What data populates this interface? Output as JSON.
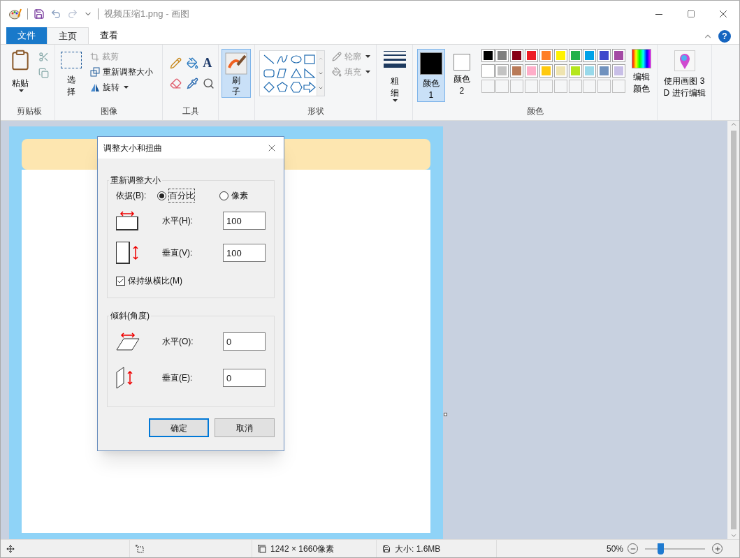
{
  "window": {
    "title": "视频压缩1.png - 画图",
    "help": "?"
  },
  "tabs": [
    {
      "label": "文件",
      "kind": "file",
      "selected": false
    },
    {
      "label": "主页",
      "kind": "tab",
      "selected": true
    },
    {
      "label": "查看",
      "kind": "tab",
      "selected": false
    }
  ],
  "ribbon": {
    "clipboard": {
      "paste": "粘贴",
      "group": "剪贴板"
    },
    "image": {
      "select": "选择",
      "crop": {
        "label": "裁剪",
        "disabled": true
      },
      "resize": {
        "label": "重新调整大小",
        "disabled": false
      },
      "rotate": {
        "label": "旋转",
        "disabled": false
      },
      "group": "图像"
    },
    "tools": {
      "text_tool": "A",
      "group": "工具"
    },
    "brushes": {
      "label": "刷子",
      "selected": true
    },
    "shapes": {
      "outline": {
        "label": "轮廓",
        "disabled": true
      },
      "fill": {
        "label": "填充",
        "disabled": true
      },
      "group": "形状"
    },
    "size": {
      "label": "粗细"
    },
    "colors": {
      "active": [
        {
          "label": "颜色 1",
          "color": "#000000",
          "selected": true
        },
        {
          "label": "颜色 2",
          "color": "#ffffff",
          "selected": false
        }
      ],
      "palette": [
        {
          "color": "#000000"
        },
        {
          "color": "#7f7f7f"
        },
        {
          "color": "#880015"
        },
        {
          "color": "#ed1c24"
        },
        {
          "color": "#ff7f27"
        },
        {
          "color": "#fff200"
        },
        {
          "color": "#22b14c"
        },
        {
          "color": "#00a2e8"
        },
        {
          "color": "#3f48cc"
        },
        {
          "color": "#a349a4"
        },
        {
          "color": "#ffffff"
        },
        {
          "color": "#c3c3c3"
        },
        {
          "color": "#b97a57"
        },
        {
          "color": "#ffaec9"
        },
        {
          "color": "#ffc90e"
        },
        {
          "color": "#efe4b0"
        },
        {
          "color": "#b5e61d"
        },
        {
          "color": "#99d9ea"
        },
        {
          "color": "#7092be"
        },
        {
          "color": "#c8bfe7"
        }
      ],
      "edit": "编辑颜色",
      "group": "颜色"
    },
    "paint3d": "使用画图 3D 进行编辑"
  },
  "dialog": {
    "title": "调整大小和扭曲",
    "resize": {
      "legend": "重新调整大小",
      "by_label": "依据(B):",
      "options": [
        {
          "label": "百分比",
          "selected": true
        },
        {
          "label": "像素",
          "selected": false
        }
      ],
      "horizontal": {
        "label": "水平(H):",
        "value": "100"
      },
      "vertical": {
        "label": "垂直(V):",
        "value": "100"
      },
      "keep_ratio": {
        "label": "保持纵横比(M)",
        "checked": true
      }
    },
    "skew": {
      "legend": "倾斜(角度)",
      "horizontal": {
        "label": "水平(O):",
        "value": "0"
      },
      "vertical": {
        "label": "垂直(E):",
        "value": "0"
      }
    },
    "buttons": [
      {
        "label": "确定",
        "kind": "primary"
      },
      {
        "label": "取消",
        "kind": "secondary"
      }
    ]
  },
  "status_bar": {
    "dimensions": "1242 × 1660像素",
    "size": "大小: 1.6MB",
    "zoom": "50%",
    "zoom_slider": {
      "level": 0.25
    }
  }
}
